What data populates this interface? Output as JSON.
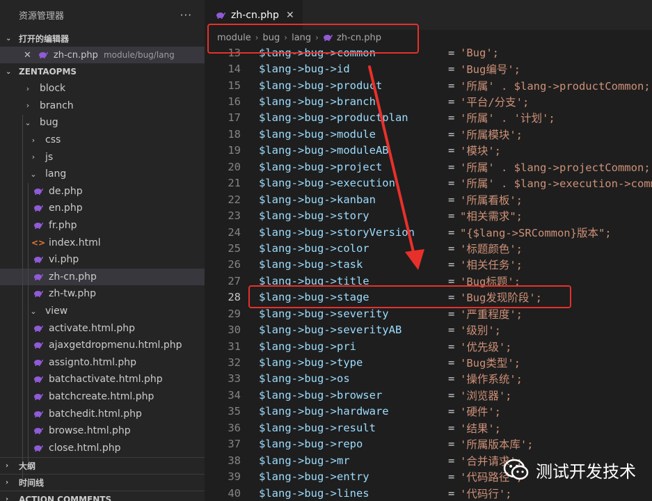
{
  "sidebar": {
    "title": "资源管理器",
    "more": "···",
    "open_editors": {
      "title": "打开的编辑器",
      "items": [
        {
          "name": "zh-cn.php",
          "path": "module/bug/lang"
        }
      ]
    },
    "project": {
      "title": "ZENTAOPMS",
      "tree": [
        {
          "label": "block",
          "type": "folder",
          "expanded": false,
          "depth": 1
        },
        {
          "label": "branch",
          "type": "folder",
          "expanded": false,
          "depth": 1
        },
        {
          "label": "bug",
          "type": "folder",
          "expanded": true,
          "depth": 1
        },
        {
          "label": "css",
          "type": "folder",
          "expanded": false,
          "depth": 2
        },
        {
          "label": "js",
          "type": "folder",
          "expanded": false,
          "depth": 2
        },
        {
          "label": "lang",
          "type": "folder",
          "expanded": true,
          "depth": 2
        },
        {
          "label": "de.php",
          "type": "php",
          "depth": 3
        },
        {
          "label": "en.php",
          "type": "php",
          "depth": 3
        },
        {
          "label": "fr.php",
          "type": "php",
          "depth": 3
        },
        {
          "label": "index.html",
          "type": "html",
          "depth": 3
        },
        {
          "label": "vi.php",
          "type": "php",
          "depth": 3
        },
        {
          "label": "zh-cn.php",
          "type": "php",
          "depth": 3,
          "selected": true
        },
        {
          "label": "zh-tw.php",
          "type": "php",
          "depth": 3
        },
        {
          "label": "view",
          "type": "folder",
          "expanded": true,
          "depth": 2
        },
        {
          "label": "activate.html.php",
          "type": "php",
          "depth": 3
        },
        {
          "label": "ajaxgetdropmenu.html.php",
          "type": "php",
          "depth": 3
        },
        {
          "label": "assignto.html.php",
          "type": "php",
          "depth": 3
        },
        {
          "label": "batchactivate.html.php",
          "type": "php",
          "depth": 3
        },
        {
          "label": "batchcreate.html.php",
          "type": "php",
          "depth": 3
        },
        {
          "label": "batchedit.html.php",
          "type": "php",
          "depth": 3
        },
        {
          "label": "browse.html.php",
          "type": "php",
          "depth": 3
        },
        {
          "label": "close.html.php",
          "type": "php",
          "depth": 3
        }
      ]
    },
    "outline": "大纲",
    "timeline": "时间线",
    "action_comments": "ACTION COMMENTS"
  },
  "editor": {
    "tab": {
      "label": "zh-cn.php"
    },
    "breadcrumb": [
      "module",
      "bug",
      "lang",
      "zh-cn.php"
    ],
    "active_line": 28,
    "lines": [
      {
        "num": "13",
        "key": "common",
        "value": "'Bug';"
      },
      {
        "num": "14",
        "key": "id",
        "value": "'Bug编号';"
      },
      {
        "num": "15",
        "key": "product",
        "value": "'所属' . $lang->productCommon;"
      },
      {
        "num": "16",
        "key": "branch",
        "value": "'平台/分支';"
      },
      {
        "num": "17",
        "key": "productplan",
        "value": "'所属' . '计划';"
      },
      {
        "num": "18",
        "key": "module",
        "value": "'所属模块';"
      },
      {
        "num": "19",
        "key": "moduleAB",
        "value": "'模块';"
      },
      {
        "num": "20",
        "key": "project",
        "value": "'所属' . $lang->projectCommon;"
      },
      {
        "num": "21",
        "key": "execution",
        "value": "'所属' . $lang->execution->common;"
      },
      {
        "num": "22",
        "key": "kanban",
        "value": "'所属看板';"
      },
      {
        "num": "23",
        "key": "story",
        "value": "\"相关需求\";"
      },
      {
        "num": "24",
        "key": "storyVersion",
        "value": "\"{$lang->SRCommon}版本\";"
      },
      {
        "num": "25",
        "key": "color",
        "value": "'标题颜色';"
      },
      {
        "num": "26",
        "key": "task",
        "value": "'相关任务';"
      },
      {
        "num": "27",
        "key": "title",
        "value": "'Bug标题';"
      },
      {
        "num": "28",
        "key": "stage",
        "value": "'Bug发现阶段';"
      },
      {
        "num": "29",
        "key": "severity",
        "value": "'严重程度';"
      },
      {
        "num": "30",
        "key": "severityAB",
        "value": "'级别';"
      },
      {
        "num": "31",
        "key": "pri",
        "value": "'优先级';"
      },
      {
        "num": "32",
        "key": "type",
        "value": "'Bug类型';"
      },
      {
        "num": "33",
        "key": "os",
        "value": "'操作系统';"
      },
      {
        "num": "34",
        "key": "browser",
        "value": "'浏览器';"
      },
      {
        "num": "35",
        "key": "hardware",
        "value": "'硬件';"
      },
      {
        "num": "36",
        "key": "result",
        "value": "'结果';"
      },
      {
        "num": "37",
        "key": "repo",
        "value": "'所属版本库';"
      },
      {
        "num": "38",
        "key": "mr",
        "value": "'合并请求';"
      },
      {
        "num": "39",
        "key": "entry",
        "value": "'代码路径';"
      },
      {
        "num": "40",
        "key": "lines",
        "value": "'代码行';"
      }
    ],
    "prefix": "$lang->bug->",
    "assign": "="
  },
  "watermark": {
    "text": "测试开发技术"
  },
  "colors": {
    "annotation": "#e8302a",
    "php_icon": "#8f5bd6",
    "accent": "#9cdcfe"
  }
}
